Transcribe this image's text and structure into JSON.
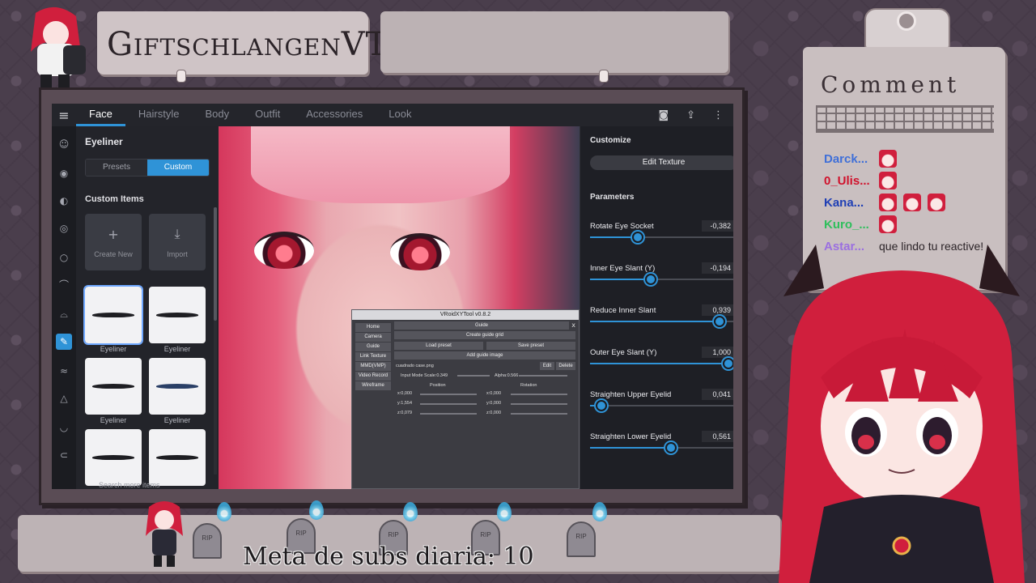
{
  "stream": {
    "channel_name": "GiftschlangenVT",
    "goal_text": "Meta de subs diaria: 10",
    "comment_header": "Comment"
  },
  "app": {
    "tabs": [
      {
        "label": "Face",
        "active": true
      },
      {
        "label": "Hairstyle",
        "active": false
      },
      {
        "label": "Body",
        "active": false
      },
      {
        "label": "Outfit",
        "active": false
      },
      {
        "label": "Accessories",
        "active": false
      },
      {
        "label": "Look",
        "active": false
      }
    ],
    "top_icons": [
      "camera-icon",
      "share-icon",
      "more-icon"
    ],
    "rail_icons": [
      "face-icon",
      "eye-icon",
      "iris-icon",
      "highlight-icon",
      "eye-white-icon",
      "eyebrow-icon",
      "eyelash-icon",
      "eyeliner-icon",
      "eyeshadow-icon",
      "nose-icon",
      "mouth-icon",
      "ear-icon"
    ],
    "left_panel": {
      "title": "Eyeliner",
      "segments": {
        "presets": "Presets",
        "custom": "Custom",
        "active": "custom"
      },
      "section": "Custom Items",
      "create_new": "Create New",
      "import": "Import",
      "items": [
        "Eyeliner",
        "Eyeliner",
        "Eyeliner",
        "Eyeliner",
        "",
        ""
      ],
      "search_more": "Search more items"
    },
    "tool_window": {
      "title": "VRoidXYTool v0.8.2",
      "close": "x",
      "nav": [
        "Home",
        "Camera",
        "Guide",
        "Link Texture",
        "MMD(VMP)",
        "Video Record",
        "Wireframe"
      ],
      "section": "Guide",
      "create_grid": "Create guide grid",
      "load_preset": "Load preset",
      "save_preset": "Save preset",
      "add_image": "Add guide image",
      "file": "cuadrado case.png",
      "edit": "Edit",
      "delete": "Delete",
      "input_mode": "Input Mode  Scale:0.349",
      "alpha": "Alpha:0.566",
      "position_label": "Position",
      "rotation_label": "Rotation",
      "pos": [
        "x:0,000",
        "y:1,554",
        "z:0,079"
      ],
      "rot": [
        "x:0,000",
        "y:0,000",
        "z:0,000"
      ]
    },
    "right_panel": {
      "heading": "Customize",
      "edit_texture": "Edit Texture",
      "parameters_label": "Parameters",
      "params": [
        {
          "name": "Rotate Eye Socket",
          "value": "-0,382",
          "fraction": 0.33
        },
        {
          "name": "Inner Eye Slant (Y)",
          "value": "-0,194",
          "fraction": 0.42
        },
        {
          "name": "Reduce Inner Slant",
          "value": "0,939",
          "fraction": 0.9
        },
        {
          "name": "Outer Eye Slant (Y)",
          "value": "1,000",
          "fraction": 0.96
        },
        {
          "name": "Straighten Upper Eyelid",
          "value": "0,041",
          "fraction": 0.08
        },
        {
          "name": "Straighten Lower Eyelid",
          "value": "0,561",
          "fraction": 0.56
        }
      ]
    }
  },
  "chat": [
    {
      "user": "Darck...",
      "color": "#3f6fd8",
      "emotes": 1,
      "message": ""
    },
    {
      "user": "0_Ulis...",
      "color": "#d0112b",
      "emotes": 1,
      "message": ""
    },
    {
      "user": "Kana...",
      "color": "#1f3fb5",
      "emotes": 3,
      "message": ""
    },
    {
      "user": "Kuro_...",
      "color": "#2fbf5c",
      "emotes": 1,
      "message": ""
    },
    {
      "user": "Astar...",
      "color": "#9b6fe0",
      "emotes": 0,
      "message": "que lindo tu reactive!"
    }
  ],
  "colors": {
    "accent": "#2f93d7",
    "hair": "#d01f3d"
  }
}
